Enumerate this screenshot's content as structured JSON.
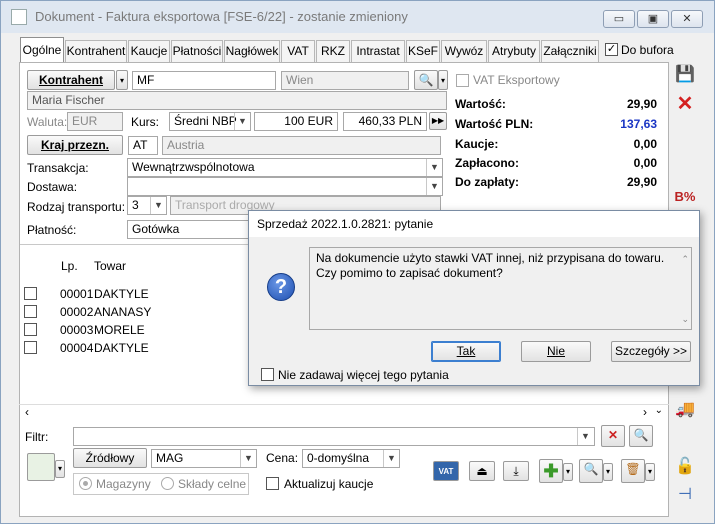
{
  "window": {
    "title": "Dokument - Faktura eksportowa [FSE-6/22] - zostanie zmieniony",
    "minimize": "▭",
    "maximize": "▣",
    "close": "✕"
  },
  "tabs": [
    "Ogólne",
    "Kontrahent",
    "Kaucje",
    "Płatności",
    "Nagłówek",
    "VAT",
    "RKZ",
    "Intrastat",
    "KSeF",
    "Wywóz",
    "Atrybuty",
    "Załączniki"
  ],
  "to_buffer": "Do bufora",
  "form": {
    "kontrahent_label": "Kontrahent",
    "kontrahent_code": "MF",
    "kontrahent_city": "Wien",
    "kontrahent_name": "Maria Fischer",
    "vat_export": "VAT Eksportowy",
    "waluta_label": "Waluta:",
    "waluta_value": "EUR",
    "kurs_label": "Kurs:",
    "kurs_type": "Średni NBP",
    "rate_base": "100 EUR",
    "rate_value": "460,33 PLN",
    "kraj_label": "Kraj przezn.",
    "kraj_code": "AT",
    "kraj_name": "Austria",
    "transakcja_label": "Transakcja:",
    "transakcja_value": "Wewnątrzwspólnotowa",
    "dostawa_label": "Dostawa:",
    "dostawa_value": "",
    "transport_label": "Rodzaj transportu:",
    "transport_code": "3",
    "transport_name": "Transport drogowy",
    "platnosc_label": "Płatność:",
    "platnosc_value": "Gotówka"
  },
  "summary": [
    {
      "label": "Wartość:",
      "value": "29,90",
      "color": "#000000"
    },
    {
      "label": "Wartość PLN:",
      "value": "137,63",
      "color": "#1a35c4"
    },
    {
      "label": "Kaucje:",
      "value": "0,00",
      "color": "#000000"
    },
    {
      "label": "Zapłacono:",
      "value": "0,00",
      "color": "#000000"
    },
    {
      "label": "Do zapłaty:",
      "value": "29,90",
      "color": "#000000"
    }
  ],
  "table": {
    "headers": [
      "Lp.",
      "Towar"
    ],
    "rows": [
      {
        "lp": "00001",
        "name": "DAKTYLE"
      },
      {
        "lp": "00002",
        "name": "ANANASY"
      },
      {
        "lp": "00003",
        "name": "MORELE"
      },
      {
        "lp": "00004",
        "name": "DAKTYLE"
      }
    ]
  },
  "filter": {
    "label": "Filtr:",
    "value": ""
  },
  "bottom": {
    "zrodlowy": "Źródłowy",
    "warehouse": "MAG",
    "cena_label": "Cena:",
    "cena_value": "0-domyślna",
    "radio1": "Magazyny",
    "radio2": "Składy celne",
    "aktualizuj": "Aktualizuj kaucje"
  },
  "dialog": {
    "title": "Sprzedaż 2022.1.0.2821: pytanie",
    "line1": "Na dokumencie użyto stawki VAT innej, niż przypisana do towaru.",
    "line2": "Czy pomimo to zapisać dokument?",
    "yes": "Tak",
    "no": "Nie",
    "details": "Szczegóły >>",
    "dont_ask": "Nie zadawaj więcej tego pytania"
  },
  "icons": {
    "save": "save-icon",
    "cancel": "cancel-icon",
    "question": "?",
    "vat": "VAT"
  }
}
